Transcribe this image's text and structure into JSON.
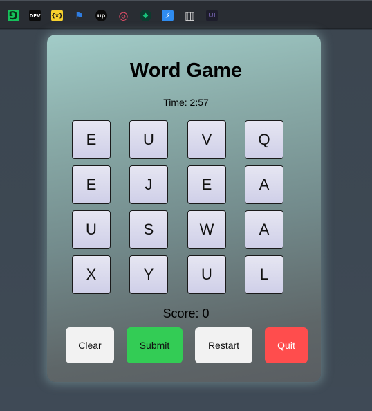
{
  "bookmarks": [
    {
      "icon": "dc-icon",
      "text": "⅁",
      "bg": "#16c15b",
      "fg": "#0a2a15"
    },
    {
      "icon": "dev-icon",
      "text": "DEV",
      "bg": "#0a0a0a",
      "fg": "#ffffff"
    },
    {
      "icon": "curly-x-icon",
      "text": "{x}",
      "bg": "#f7d12e",
      "fg": "#111111"
    },
    {
      "icon": "flag-icon",
      "text": "⚑",
      "bg": "transparent",
      "fg": "#2f7de1"
    },
    {
      "icon": "up-icon",
      "text": "up",
      "bg": "#0b0b0b",
      "fg": "#ffffff"
    },
    {
      "icon": "swirl-icon",
      "text": "◎",
      "bg": "transparent",
      "fg": "#e94f6a"
    },
    {
      "icon": "leaf-icon",
      "text": "◆",
      "bg": "#0d3b2e",
      "fg": "#18c37a"
    },
    {
      "icon": "bolt-icon",
      "text": "⚡",
      "bg": "#2f8cf0",
      "fg": "#ffffff"
    },
    {
      "icon": "panel-icon",
      "text": "▥",
      "bg": "transparent",
      "fg": "#d9d9d9"
    },
    {
      "icon": "ui-icon",
      "text": "UI",
      "bg": "#1d1d2b",
      "fg": "#a98cff"
    }
  ],
  "game": {
    "title": "Word Game",
    "timer": "Time: 2:57",
    "score": "Score: 0",
    "grid": [
      [
        "E",
        "U",
        "V",
        "Q"
      ],
      [
        "E",
        "J",
        "E",
        "A"
      ],
      [
        "U",
        "S",
        "W",
        "A"
      ],
      [
        "X",
        "Y",
        "U",
        "L"
      ]
    ]
  },
  "buttons": {
    "clear": {
      "label": "Clear",
      "color": "#f2f2f2"
    },
    "submit": {
      "label": "Submit",
      "color": "#33cc55"
    },
    "restart": {
      "label": "Restart",
      "color": "#f2f2f2"
    },
    "quit": {
      "label": "Quit",
      "color": "#ff4d4d"
    }
  }
}
